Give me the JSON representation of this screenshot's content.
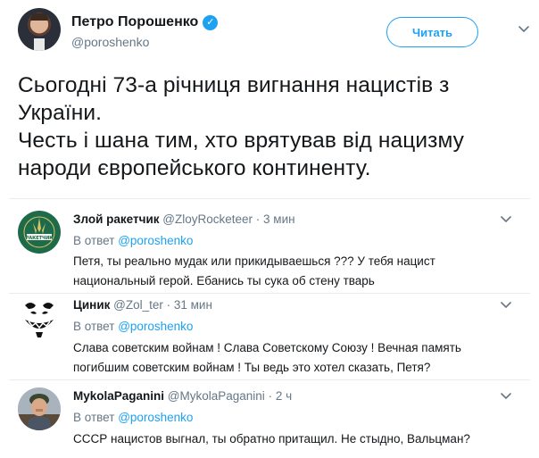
{
  "main_tweet": {
    "author_name": "Петро Порошенко",
    "handle": "@poroshenko",
    "follow_label": "Читать",
    "text_lines": [
      "Сьогодні 73-а річниця вигнання нацистів з",
      "України.",
      "Честь і шана тим, хто врятував від нацизму",
      "народи європейського континенту."
    ]
  },
  "replies": [
    {
      "author_name": "Злой ракетчик",
      "handle": "@ZloyRocketeer",
      "time": "· 3 мин",
      "in_reply_prefix": "В ответ",
      "in_reply_mention": "@poroshenko",
      "text_lines": [
        "Петя, ты реально мудак или прикидываешься ??? У тебя нацист",
        "национальный герой. Ебанись ты сука об стену тварь"
      ],
      "avatar_text": "РАКЕТЧИК"
    },
    {
      "author_name": "Циник",
      "handle": "@Zol_ter",
      "time": "· 31 мин",
      "in_reply_prefix": "В ответ",
      "in_reply_mention": "@poroshenko",
      "text_lines": [
        "Слава советским войнам ! Слава Советскому Союзу !  Вечная память",
        "погибшим советским войнам !  Ты ведь это хотел сказать, Петя?"
      ]
    },
    {
      "author_name": "MykolaPaganini",
      "handle": "@MykolaPaganini",
      "time": "· 2 ч",
      "in_reply_prefix": "В ответ",
      "in_reply_mention": "@poroshenko",
      "text_lines": [
        "СССР нацистов выгнал, ты обратно притащил. Не стыдно, Вальцман?"
      ]
    }
  ],
  "colors": {
    "accent": "#1da1f2",
    "text": "#14171a",
    "muted": "#657786",
    "divider": "#e6ecf0"
  },
  "icons": {
    "verified": "verified-badge-icon",
    "more": "chevron-down-icon"
  }
}
